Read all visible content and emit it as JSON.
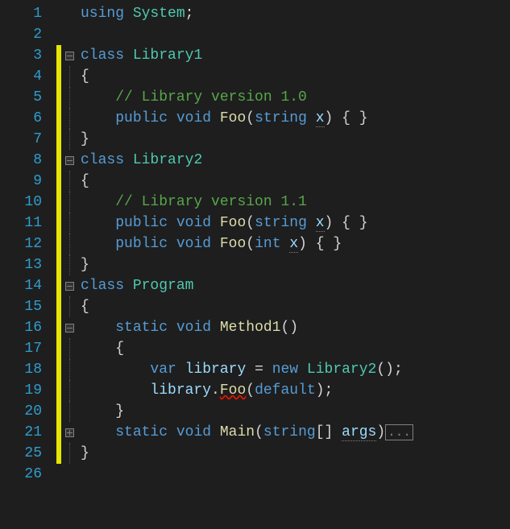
{
  "lineNumbers": [
    "1",
    "2",
    "3",
    "4",
    "5",
    "6",
    "7",
    "8",
    "9",
    "10",
    "11",
    "12",
    "13",
    "14",
    "15",
    "16",
    "17",
    "18",
    "19",
    "20",
    "21",
    "25",
    "26"
  ],
  "tokens": {
    "using": "using",
    "system": "System",
    "class": "class",
    "lib1": "Library1",
    "lib2": "Library2",
    "program": "Program",
    "comment10": "// Library version 1.0",
    "comment11": "// Library version 1.1",
    "public": "public",
    "void": "void",
    "foo": "Foo",
    "string": "string",
    "int": "int",
    "x": "x",
    "static": "static",
    "method1": "Method1",
    "var": "var",
    "library": "library",
    "new": "new",
    "default": "default",
    "main": "Main",
    "args": "args",
    "brackets": "[]",
    "lbr": "{",
    "rbr": "}",
    "lp": "(",
    "rp": ")",
    "sc": ";",
    "dot": ".",
    "eq": "=",
    "comma": ",",
    "empty_braces": "{ }",
    "ellipsis": "..."
  }
}
